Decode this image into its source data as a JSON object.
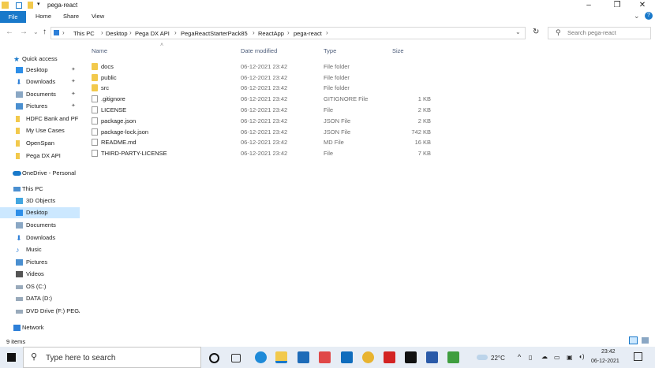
{
  "window": {
    "title": "pega-react",
    "controls": {
      "minimize": "–",
      "maximize": "❐",
      "close": "✕"
    }
  },
  "ribbon": {
    "tabs": [
      "File",
      "Home",
      "Share",
      "View"
    ]
  },
  "address": {
    "crumbs": [
      "This PC",
      "Desktop",
      "Pega DX API",
      "PegaReactStarterPack85",
      "ReactApp",
      "pega-react"
    ],
    "search_placeholder": "Search pega-react"
  },
  "navpane": {
    "quick_access": "Quick access",
    "quick_items": [
      {
        "label": "Desktop",
        "icon": "desktop-icon",
        "pinned": true
      },
      {
        "label": "Downloads",
        "icon": "downloads-icon",
        "pinned": true
      },
      {
        "label": "Documents",
        "icon": "documents-icon",
        "pinned": true
      },
      {
        "label": "Pictures",
        "icon": "pictures-icon",
        "pinned": true
      },
      {
        "label": "HDFC Bank and PF",
        "icon": "folder-icon",
        "pinned": false
      },
      {
        "label": "My Use Cases",
        "icon": "folder-icon",
        "pinned": false
      },
      {
        "label": "OpenSpan",
        "icon": "folder-icon",
        "pinned": false
      },
      {
        "label": "Pega DX API",
        "icon": "folder-icon",
        "pinned": false
      }
    ],
    "onedrive": "OneDrive - Personal",
    "this_pc": "This PC",
    "pc_items": [
      {
        "label": "3D Objects",
        "icon": "3d-objects-icon"
      },
      {
        "label": "Desktop",
        "icon": "desktop-icon",
        "selected": true
      },
      {
        "label": "Documents",
        "icon": "documents-icon"
      },
      {
        "label": "Downloads",
        "icon": "downloads-icon"
      },
      {
        "label": "Music",
        "icon": "music-icon"
      },
      {
        "label": "Pictures",
        "icon": "pictures-icon"
      },
      {
        "label": "Videos",
        "icon": "videos-icon"
      },
      {
        "label": "OS (C:)",
        "icon": "drive-icon"
      },
      {
        "label": "DATA (D:)",
        "icon": "drive-icon"
      },
      {
        "label": "DVD Drive (F:) PEGA",
        "icon": "dvd-drive-icon"
      }
    ],
    "network": "Network"
  },
  "filelist": {
    "headers": {
      "name": "Name",
      "date": "Date modified",
      "type": "Type",
      "size": "Size"
    },
    "rows": [
      {
        "name": "docs",
        "date": "06-12-2021 23:42",
        "type": "File folder",
        "size": "",
        "kind": "folder"
      },
      {
        "name": "public",
        "date": "06-12-2021 23:42",
        "type": "File folder",
        "size": "",
        "kind": "folder"
      },
      {
        "name": "src",
        "date": "06-12-2021 23:42",
        "type": "File folder",
        "size": "",
        "kind": "folder"
      },
      {
        "name": ".gitignore",
        "date": "06-12-2021 23:42",
        "type": "GITIGNORE File",
        "size": "1 KB",
        "kind": "file"
      },
      {
        "name": "LICENSE",
        "date": "06-12-2021 23:42",
        "type": "File",
        "size": "2 KB",
        "kind": "file"
      },
      {
        "name": "package.json",
        "date": "06-12-2021 23:42",
        "type": "JSON File",
        "size": "2 KB",
        "kind": "file"
      },
      {
        "name": "package-lock.json",
        "date": "06-12-2021 23:42",
        "type": "JSON File",
        "size": "742 KB",
        "kind": "file"
      },
      {
        "name": "README.md",
        "date": "06-12-2021 23:42",
        "type": "MD File",
        "size": "16 KB",
        "kind": "file"
      },
      {
        "name": "THIRD-PARTY-LICENSE",
        "date": "06-12-2021 23:42",
        "type": "File",
        "size": "7 KB",
        "kind": "file"
      }
    ]
  },
  "status": {
    "item_count": "9 items"
  },
  "taskbar": {
    "search_text": "Type here to search",
    "temperature": "22°C",
    "time": "23:42",
    "date": "06-12-2021"
  },
  "colors": {
    "accent": "#1979ca",
    "folder": "#f2c94c",
    "selected": "#cce8ff"
  }
}
